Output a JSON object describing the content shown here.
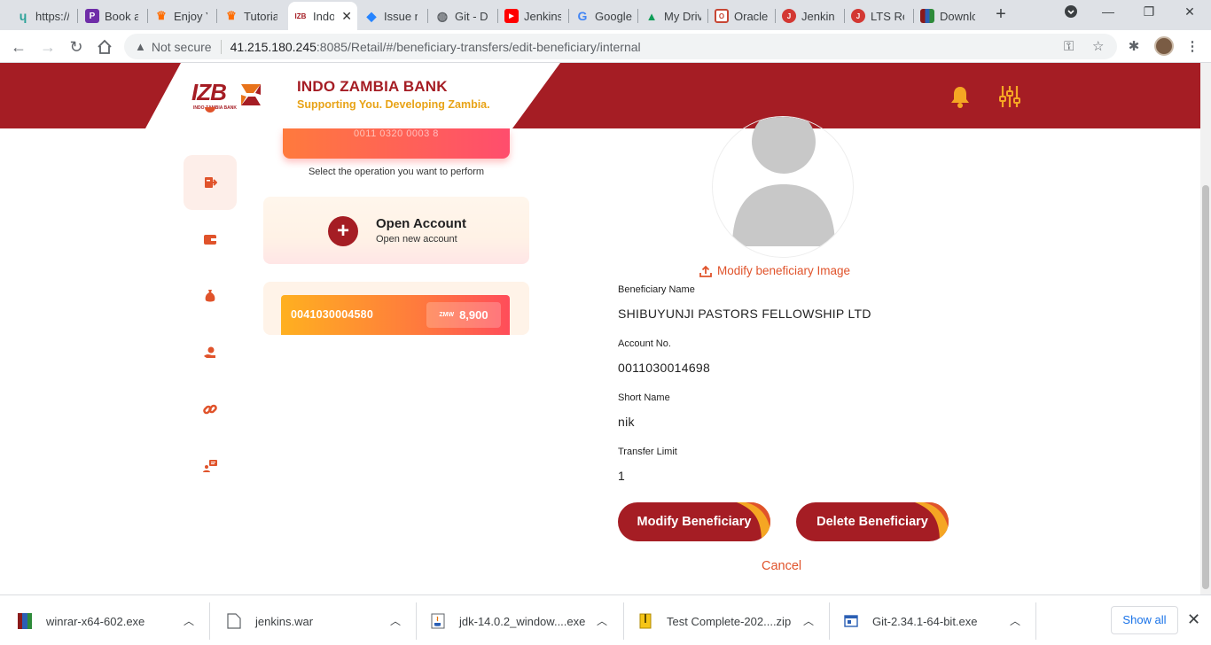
{
  "browser": {
    "tabs": [
      {
        "label": "https://",
        "icon": "leaf-icon",
        "color": "#2aa198"
      },
      {
        "label": "Book a",
        "icon": "p-icon",
        "color": "#6f2da8"
      },
      {
        "label": "Enjoy Y",
        "icon": "crown-icon",
        "color": "#ff6d00"
      },
      {
        "label": "Tutorial",
        "icon": "crown-icon",
        "color": "#ff6d00"
      },
      {
        "label": "Indo",
        "icon": "izb-icon",
        "color": "#a51d24"
      },
      {
        "label": "Issue n",
        "icon": "jira-icon",
        "color": "#2684ff"
      },
      {
        "label": "Git - Do",
        "icon": "globe-icon",
        "color": "#5f6368"
      },
      {
        "label": "Jenkins",
        "icon": "youtube-icon",
        "color": "#ff0000"
      },
      {
        "label": "Google",
        "icon": "google-icon",
        "color": "#4285f4"
      },
      {
        "label": "My Driv",
        "icon": "drive-icon",
        "color": "#0f9d58"
      },
      {
        "label": "Oracle",
        "icon": "oracle-icon",
        "color": "#c74634"
      },
      {
        "label": "Jenkins",
        "icon": "jenkins-icon",
        "color": "#d33833"
      },
      {
        "label": "LTS Rel",
        "icon": "jenkins-icon",
        "color": "#d33833"
      },
      {
        "label": "Downlo",
        "icon": "winrar-icon",
        "color": "#8b1a1a"
      }
    ],
    "security_label": "Not secure",
    "url_host": "41.215.180.245",
    "url_path": ":8085/Retail/#/beneficiary-transfers/edit-beneficiary/internal"
  },
  "header": {
    "logo_text": "IZB",
    "logo_subtext": "INDO ZAMBIA BANK",
    "bank_name": "INDO ZAMBIA BANK",
    "tagline": "Supporting You. Developing Zambia."
  },
  "left": {
    "card_number_partial": "0011 0320 0003 8",
    "select_operation": "Select the operation you want to perform",
    "open_account_title": "Open Account",
    "open_account_subtitle": "Open new account",
    "account_number": "0041030004580",
    "currency": "ZMW",
    "balance": "8,900"
  },
  "beneficiary": {
    "modify_image_label": "Modify beneficiary Image",
    "name_label": "Beneficiary Name",
    "name_value": "SHIBUYUNJI PASTORS FELLOWSHIP LTD",
    "account_label": "Account No.",
    "account_value": "0011030014698",
    "short_name_label": "Short Name",
    "short_name_value": "nik",
    "limit_label": "Transfer Limit",
    "limit_value": "1",
    "modify_button": "Modify Beneficiary",
    "delete_button": "Delete Beneficiary",
    "cancel_label": "Cancel"
  },
  "downloads": {
    "items": [
      {
        "name": "winrar-x64-602.exe",
        "icon": "winrar-icon"
      },
      {
        "name": "jenkins.war",
        "icon": "file-icon"
      },
      {
        "name": "jdk-14.0.2_window....exe",
        "icon": "java-icon"
      },
      {
        "name": "Test Complete-202....zip",
        "icon": "zip-icon"
      },
      {
        "name": "Git-2.34.1-64-bit.exe",
        "icon": "installer-icon"
      }
    ],
    "show_all": "Show all"
  },
  "colors": {
    "brand_red": "#a51d24",
    "accent_orange": "#e0532b",
    "tagline_gold": "#e8a317"
  }
}
